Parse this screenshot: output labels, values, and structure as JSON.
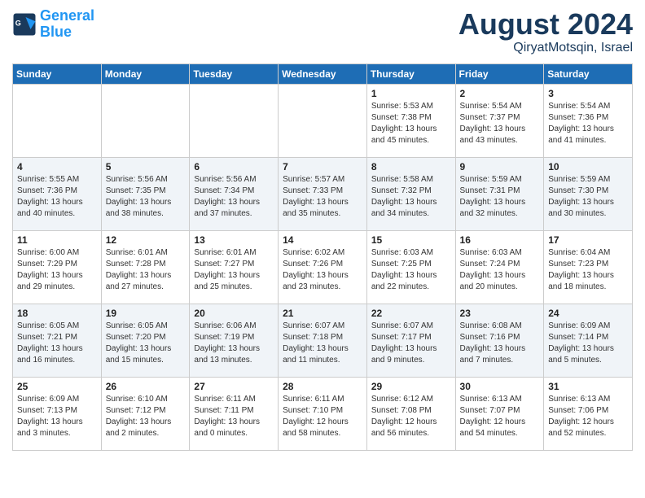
{
  "header": {
    "logo_line1": "General",
    "logo_line2": "Blue",
    "title": "August 2024",
    "subtitle": "QiryatMotsqin, Israel"
  },
  "weekdays": [
    "Sunday",
    "Monday",
    "Tuesday",
    "Wednesday",
    "Thursday",
    "Friday",
    "Saturday"
  ],
  "weeks": [
    [
      {
        "day": "",
        "info": ""
      },
      {
        "day": "",
        "info": ""
      },
      {
        "day": "",
        "info": ""
      },
      {
        "day": "",
        "info": ""
      },
      {
        "day": "1",
        "sunrise": "5:53 AM",
        "sunset": "7:38 PM",
        "daylight": "13 hours and 45 minutes."
      },
      {
        "day": "2",
        "sunrise": "5:54 AM",
        "sunset": "7:37 PM",
        "daylight": "13 hours and 43 minutes."
      },
      {
        "day": "3",
        "sunrise": "5:54 AM",
        "sunset": "7:36 PM",
        "daylight": "13 hours and 41 minutes."
      }
    ],
    [
      {
        "day": "4",
        "sunrise": "5:55 AM",
        "sunset": "7:36 PM",
        "daylight": "13 hours and 40 minutes."
      },
      {
        "day": "5",
        "sunrise": "5:56 AM",
        "sunset": "7:35 PM",
        "daylight": "13 hours and 38 minutes."
      },
      {
        "day": "6",
        "sunrise": "5:56 AM",
        "sunset": "7:34 PM",
        "daylight": "13 hours and 37 minutes."
      },
      {
        "day": "7",
        "sunrise": "5:57 AM",
        "sunset": "7:33 PM",
        "daylight": "13 hours and 35 minutes."
      },
      {
        "day": "8",
        "sunrise": "5:58 AM",
        "sunset": "7:32 PM",
        "daylight": "13 hours and 34 minutes."
      },
      {
        "day": "9",
        "sunrise": "5:59 AM",
        "sunset": "7:31 PM",
        "daylight": "13 hours and 32 minutes."
      },
      {
        "day": "10",
        "sunrise": "5:59 AM",
        "sunset": "7:30 PM",
        "daylight": "13 hours and 30 minutes."
      }
    ],
    [
      {
        "day": "11",
        "sunrise": "6:00 AM",
        "sunset": "7:29 PM",
        "daylight": "13 hours and 29 minutes."
      },
      {
        "day": "12",
        "sunrise": "6:01 AM",
        "sunset": "7:28 PM",
        "daylight": "13 hours and 27 minutes."
      },
      {
        "day": "13",
        "sunrise": "6:01 AM",
        "sunset": "7:27 PM",
        "daylight": "13 hours and 25 minutes."
      },
      {
        "day": "14",
        "sunrise": "6:02 AM",
        "sunset": "7:26 PM",
        "daylight": "13 hours and 23 minutes."
      },
      {
        "day": "15",
        "sunrise": "6:03 AM",
        "sunset": "7:25 PM",
        "daylight": "13 hours and 22 minutes."
      },
      {
        "day": "16",
        "sunrise": "6:03 AM",
        "sunset": "7:24 PM",
        "daylight": "13 hours and 20 minutes."
      },
      {
        "day": "17",
        "sunrise": "6:04 AM",
        "sunset": "7:23 PM",
        "daylight": "13 hours and 18 minutes."
      }
    ],
    [
      {
        "day": "18",
        "sunrise": "6:05 AM",
        "sunset": "7:21 PM",
        "daylight": "13 hours and 16 minutes."
      },
      {
        "day": "19",
        "sunrise": "6:05 AM",
        "sunset": "7:20 PM",
        "daylight": "13 hours and 15 minutes."
      },
      {
        "day": "20",
        "sunrise": "6:06 AM",
        "sunset": "7:19 PM",
        "daylight": "13 hours and 13 minutes."
      },
      {
        "day": "21",
        "sunrise": "6:07 AM",
        "sunset": "7:18 PM",
        "daylight": "13 hours and 11 minutes."
      },
      {
        "day": "22",
        "sunrise": "6:07 AM",
        "sunset": "7:17 PM",
        "daylight": "13 hours and 9 minutes."
      },
      {
        "day": "23",
        "sunrise": "6:08 AM",
        "sunset": "7:16 PM",
        "daylight": "13 hours and 7 minutes."
      },
      {
        "day": "24",
        "sunrise": "6:09 AM",
        "sunset": "7:14 PM",
        "daylight": "13 hours and 5 minutes."
      }
    ],
    [
      {
        "day": "25",
        "sunrise": "6:09 AM",
        "sunset": "7:13 PM",
        "daylight": "13 hours and 3 minutes."
      },
      {
        "day": "26",
        "sunrise": "6:10 AM",
        "sunset": "7:12 PM",
        "daylight": "13 hours and 2 minutes."
      },
      {
        "day": "27",
        "sunrise": "6:11 AM",
        "sunset": "7:11 PM",
        "daylight": "13 hours and 0 minutes."
      },
      {
        "day": "28",
        "sunrise": "6:11 AM",
        "sunset": "7:10 PM",
        "daylight": "12 hours and 58 minutes."
      },
      {
        "day": "29",
        "sunrise": "6:12 AM",
        "sunset": "7:08 PM",
        "daylight": "12 hours and 56 minutes."
      },
      {
        "day": "30",
        "sunrise": "6:13 AM",
        "sunset": "7:07 PM",
        "daylight": "12 hours and 54 minutes."
      },
      {
        "day": "31",
        "sunrise": "6:13 AM",
        "sunset": "7:06 PM",
        "daylight": "12 hours and 52 minutes."
      }
    ]
  ]
}
